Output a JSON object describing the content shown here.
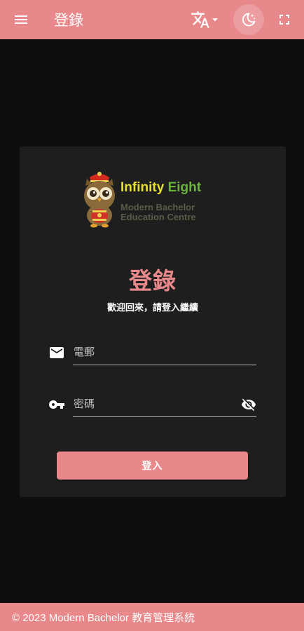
{
  "topbar": {
    "title": "登錄",
    "menu_icon": "menu-icon",
    "translate_icon": "translate-icon",
    "theme_icon": "dark-mode-icon",
    "fullscreen_icon": "fullscreen-icon"
  },
  "logo": {
    "word1": "Infinity",
    "word2": "Eight",
    "line1": "Modern Bachelor",
    "line2": "Education Centre"
  },
  "login": {
    "title": "登錄",
    "subtitle": "歡迎回來，請登入繼續",
    "email_placeholder": "電郵",
    "password_placeholder": "密碼",
    "submit_label": "登入"
  },
  "footer": {
    "text": "© 2023 Modern Bachelor 教育管理系統"
  },
  "colors": {
    "accent": "#e8888a",
    "background": "#0e0e0e",
    "card": "#1e1e1e"
  }
}
